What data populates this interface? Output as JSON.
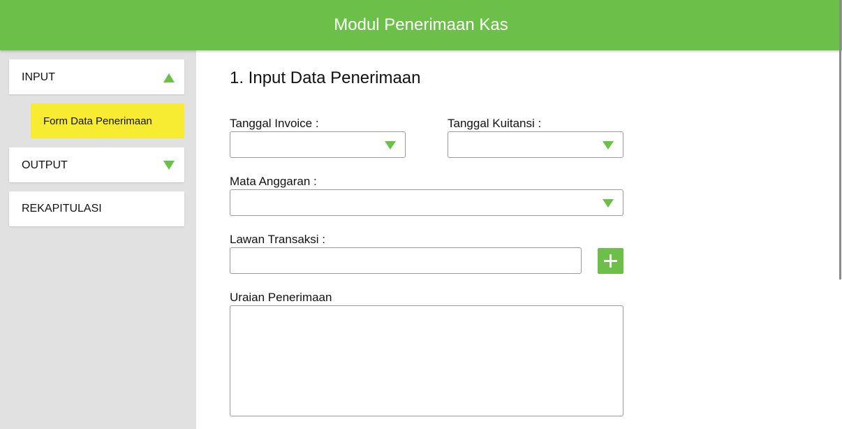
{
  "header": {
    "title": "Modul Penerimaan Kas"
  },
  "sidebar": {
    "items": [
      {
        "label": "INPUT",
        "icon": "chevron-up-icon",
        "expanded": true
      },
      {
        "label": "Form Data Penerimaan",
        "selected": true
      },
      {
        "label": "OUTPUT",
        "icon": "chevron-down-icon",
        "expanded": false
      },
      {
        "label": "REKAPITULASI"
      }
    ]
  },
  "form": {
    "title": "1. Input Data Penerimaan",
    "tanggal_invoice": {
      "label": "Tanggal Invoice :",
      "value": ""
    },
    "tanggal_kuitansi": {
      "label": "Tanggal Kuitansi :",
      "value": ""
    },
    "mata_anggaran": {
      "label": "Mata Anggaran :",
      "value": ""
    },
    "lawan_transaksi": {
      "label": "Lawan Transaksi :",
      "value": "",
      "add_icon": "plus-icon"
    },
    "uraian": {
      "label": "Uraian Penerimaan",
      "value": ""
    }
  },
  "colors": {
    "accent": "#6cc04a",
    "highlight": "#f8ec32",
    "sidebar_bg": "#e1e1e1"
  }
}
